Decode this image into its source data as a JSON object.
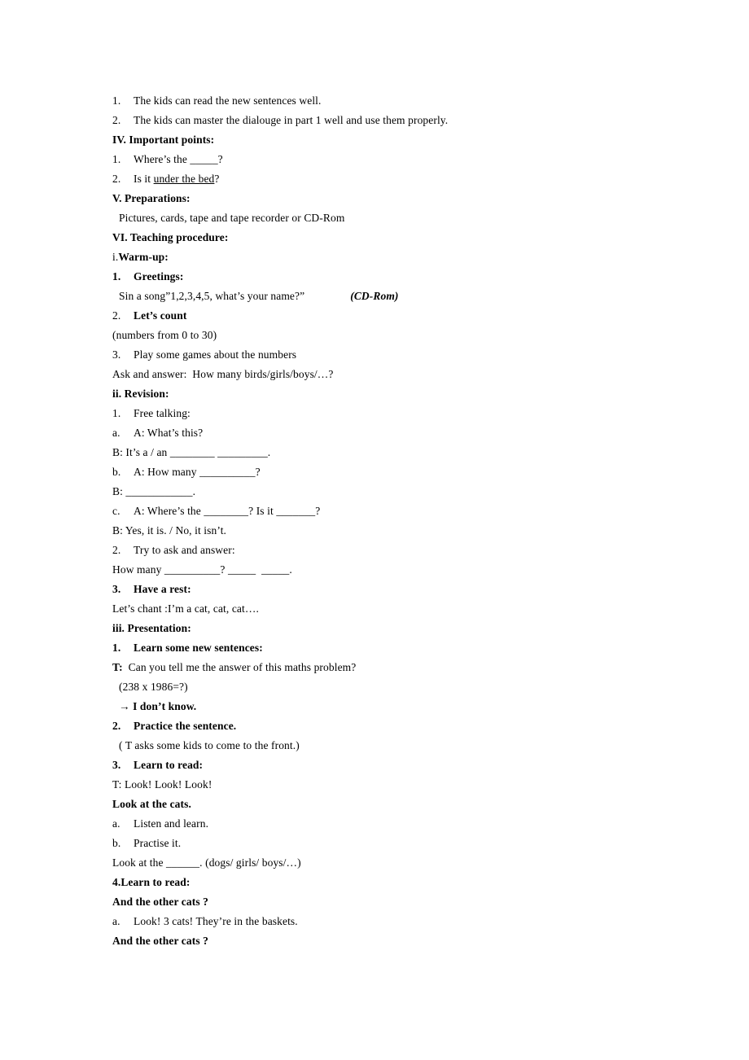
{
  "document": {
    "type": "lesson-plan",
    "background_color": "#ffffff",
    "text_color": "#000000",
    "lines": [
      {
        "id": "l1",
        "marker": "1.",
        "text": "The kids can read the new sentences well.",
        "style": "normal",
        "indent": "hang"
      },
      {
        "id": "l2",
        "marker": "2.",
        "text": "The kids can master the dialouge in part 1 well and use them properly.",
        "style": "normal",
        "indent": "hang"
      },
      {
        "id": "l3",
        "marker": "",
        "text": "IV. Important points:",
        "style": "bold",
        "indent": "none"
      },
      {
        "id": "l4",
        "marker": "1.",
        "text": "Where’s the _____?",
        "style": "normal",
        "indent": "hang"
      },
      {
        "id": "l5",
        "marker": "2.",
        "text": "Is it under the bed?",
        "style": "normal-underline-part",
        "underline_text": "under the bed",
        "prefix": "Is it ",
        "suffix": "?",
        "indent": "hang"
      },
      {
        "id": "l6",
        "marker": "",
        "text": "V. Preparations:",
        "style": "bold",
        "indent": "none"
      },
      {
        "id": "l7",
        "marker": "",
        "text": "Pictures, cards, tape and tape recorder or CD-Rom",
        "style": "normal",
        "indent": "small"
      },
      {
        "id": "l8",
        "marker": "",
        "text": "VI. Teaching procedure:",
        "style": "bold",
        "indent": "none"
      },
      {
        "id": "l9",
        "marker": "i.",
        "text": "Warm-up:",
        "style": "mixed-roman-bold",
        "roman": "i.",
        "indent": "none"
      },
      {
        "id": "l10",
        "marker": "1.",
        "text": "Greetings:",
        "style": "bold",
        "indent": "hang"
      },
      {
        "id": "l11",
        "marker": "",
        "text": "Sin a song”1,2,3,4,5, what’s your name?”",
        "trailing": "(CD-Rom)",
        "style": "normal-with-bolditalic-tail",
        "indent": "small"
      },
      {
        "id": "l12",
        "marker": "2.",
        "text": "Let’s count",
        "style": "bold-text-plain-num",
        "indent": "hang"
      },
      {
        "id": "l13",
        "marker": "",
        "text": "(numbers from 0 to 30)",
        "style": "normal",
        "indent": "none"
      },
      {
        "id": "l14",
        "marker": "3.",
        "text": "Play some games about the numbers",
        "style": "normal",
        "indent": "hang"
      },
      {
        "id": "l15",
        "marker": "",
        "text": "Ask and answer:  How many birds/girls/boys/…?",
        "style": "normal",
        "indent": "none"
      },
      {
        "id": "l16",
        "marker": "",
        "text": "ii. Revision:",
        "style": "bold",
        "indent": "none"
      },
      {
        "id": "l17",
        "marker": "1.",
        "text": "Free talking:",
        "style": "normal",
        "indent": "hang"
      },
      {
        "id": "l18",
        "marker": "a.",
        "text": "A: What’s this?",
        "style": "normal",
        "indent": "hang"
      },
      {
        "id": "l19",
        "marker": "",
        "text": "B: It’s a / an ________ _________.",
        "style": "normal",
        "indent": "none"
      },
      {
        "id": "l20",
        "marker": "b.",
        "text": "A: How many __________?",
        "style": "normal",
        "indent": "hang"
      },
      {
        "id": "l21",
        "marker": "",
        "text": "B: ____________.",
        "style": "normal",
        "indent": "none"
      },
      {
        "id": "l22",
        "marker": "c.",
        "text": "A: Where’s the ________? Is it _______?",
        "style": "normal",
        "indent": "hang"
      },
      {
        "id": "l23",
        "marker": "",
        "text": "B: Yes, it is. / No, it isn’t.",
        "style": "normal",
        "indent": "none"
      },
      {
        "id": "l24",
        "marker": "2.",
        "text": "Try to ask and answer:",
        "style": "normal",
        "indent": "hang"
      },
      {
        "id": "l25",
        "marker": "",
        "text": "How many __________? _____  _____.",
        "style": "normal",
        "indent": "none"
      },
      {
        "id": "l26",
        "marker": "3.",
        "text": "Have a rest:",
        "style": "bold",
        "indent": "hang"
      },
      {
        "id": "l27",
        "marker": "",
        "text": "Let’s chant :I’m a cat, cat, cat….",
        "style": "normal",
        "indent": "none"
      },
      {
        "id": "l28",
        "marker": "",
        "text": "iii. Presentation:",
        "style": "bold",
        "indent": "none"
      },
      {
        "id": "l29",
        "marker": "1.",
        "text": "Learn some new sentences:",
        "style": "bold",
        "indent": "hang"
      },
      {
        "id": "l30",
        "marker": "",
        "text": "T:  Can you tell me the answer of this maths problem?",
        "style": "bold-prefix",
        "bold_prefix": "T:",
        "rest": "  Can you tell me the answer of this maths problem?",
        "indent": "none"
      },
      {
        "id": "l31",
        "marker": "",
        "text": "(238 x 1986=?)",
        "style": "normal",
        "indent": "small"
      },
      {
        "id": "l32",
        "marker": "",
        "text": "→ I don’t know.",
        "style": "bold",
        "indent": "small"
      },
      {
        "id": "l33",
        "marker": "2.",
        "text": "Practice the sentence.",
        "style": "bold",
        "indent": "hang"
      },
      {
        "id": "l34",
        "marker": "",
        "text": "( T asks some kids to come to the front.)",
        "style": "normal",
        "indent": "small"
      },
      {
        "id": "l35",
        "marker": "3.",
        "text": "Learn to read:",
        "style": "bold",
        "indent": "hang"
      },
      {
        "id": "l36",
        "marker": "",
        "text": "T: Look! Look! Look!",
        "style": "normal",
        "indent": "none"
      },
      {
        "id": "l37",
        "marker": "",
        "text": "Look at the cats.",
        "style": "bold",
        "indent": "none"
      },
      {
        "id": "l38",
        "marker": "a.",
        "text": "Listen and learn.",
        "style": "normal",
        "indent": "hang"
      },
      {
        "id": "l39",
        "marker": "b.",
        "text": "Practise it.",
        "style": "normal",
        "indent": "hang"
      },
      {
        "id": "l40",
        "marker": "",
        "text": "Look at the ______. (dogs/ girls/ boys/…)",
        "style": "normal",
        "indent": "none"
      },
      {
        "id": "l41",
        "marker": "",
        "text": "4.Learn to read:",
        "style": "bold",
        "indent": "none"
      },
      {
        "id": "l42",
        "marker": "",
        "text": "And the other cats ?",
        "style": "bold",
        "indent": "none"
      },
      {
        "id": "l43",
        "marker": "a.",
        "text": "Look! 3 cats! They’re in the baskets.",
        "style": "normal",
        "indent": "hang"
      },
      {
        "id": "l44",
        "marker": "",
        "text": "And the other cats ?",
        "style": "bold",
        "indent": "none"
      }
    ]
  }
}
